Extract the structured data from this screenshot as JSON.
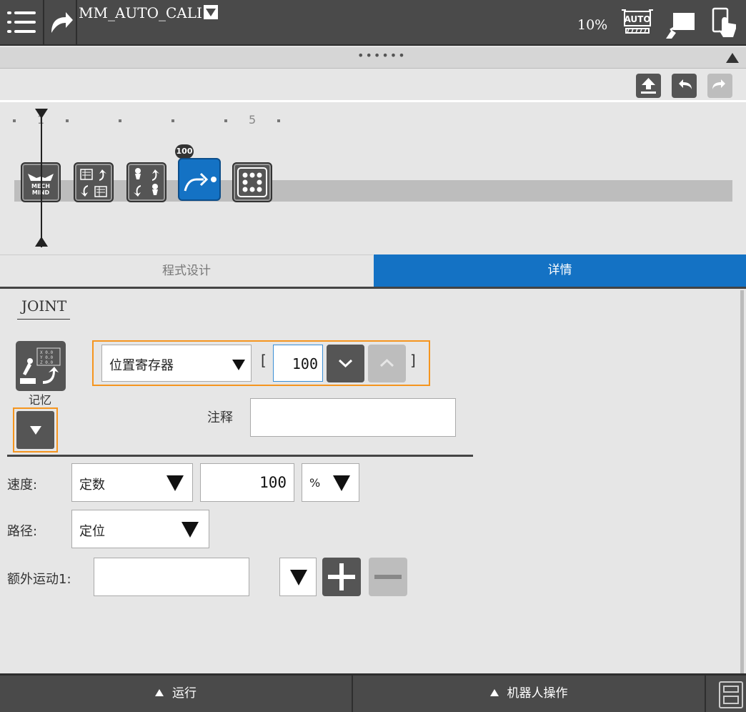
{
  "header": {
    "program_name": "MM_AUTO_CALI",
    "speed": "10%",
    "auto_label": "AUTO"
  },
  "timeline": {
    "tick_labels": [
      "1",
      "5"
    ],
    "node_badge": "100",
    "mech_logo_line1": "MECH",
    "mech_logo_line2": "MIND"
  },
  "tabs": {
    "program": "程式设计",
    "details": "详情"
  },
  "detail": {
    "motion_type": "JOINT",
    "memory_label": "记忆",
    "position_source": "位置寄存器",
    "register_bracket_open": "[",
    "register_bracket_close": "]",
    "register_index": "100",
    "comment_label": "注释",
    "comment_value": "",
    "speed_label": "速度:",
    "speed_type": "定数",
    "speed_value": "100",
    "speed_unit": "%",
    "path_label": "路径:",
    "path_type": "定位",
    "extra_motion_label": "额外运动1:",
    "extra_motion_value": ""
  },
  "bottom": {
    "run": "运行",
    "robot_ops": "机器人操作"
  },
  "colors": {
    "accent": "#1472c4",
    "highlight": "#f5951f",
    "header": "#4a4a4a"
  }
}
